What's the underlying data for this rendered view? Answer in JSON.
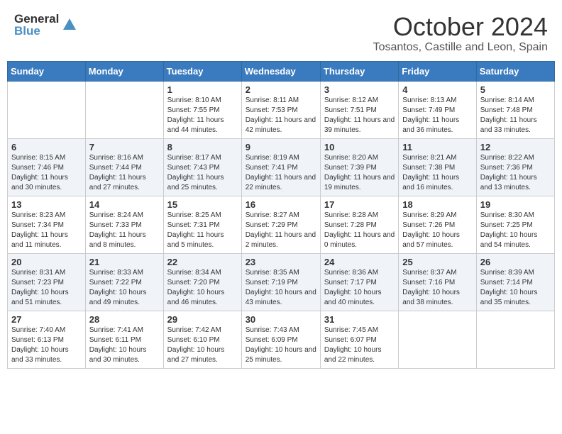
{
  "header": {
    "logo_general": "General",
    "logo_blue": "Blue",
    "month_title": "October 2024",
    "location": "Tosantos, Castille and Leon, Spain"
  },
  "days_of_week": [
    "Sunday",
    "Monday",
    "Tuesday",
    "Wednesday",
    "Thursday",
    "Friday",
    "Saturday"
  ],
  "weeks": [
    [
      {
        "day": "",
        "info": ""
      },
      {
        "day": "",
        "info": ""
      },
      {
        "day": "1",
        "info": "Sunrise: 8:10 AM\nSunset: 7:55 PM\nDaylight: 11 hours and 44 minutes."
      },
      {
        "day": "2",
        "info": "Sunrise: 8:11 AM\nSunset: 7:53 PM\nDaylight: 11 hours and 42 minutes."
      },
      {
        "day": "3",
        "info": "Sunrise: 8:12 AM\nSunset: 7:51 PM\nDaylight: 11 hours and 39 minutes."
      },
      {
        "day": "4",
        "info": "Sunrise: 8:13 AM\nSunset: 7:49 PM\nDaylight: 11 hours and 36 minutes."
      },
      {
        "day": "5",
        "info": "Sunrise: 8:14 AM\nSunset: 7:48 PM\nDaylight: 11 hours and 33 minutes."
      }
    ],
    [
      {
        "day": "6",
        "info": "Sunrise: 8:15 AM\nSunset: 7:46 PM\nDaylight: 11 hours and 30 minutes."
      },
      {
        "day": "7",
        "info": "Sunrise: 8:16 AM\nSunset: 7:44 PM\nDaylight: 11 hours and 27 minutes."
      },
      {
        "day": "8",
        "info": "Sunrise: 8:17 AM\nSunset: 7:43 PM\nDaylight: 11 hours and 25 minutes."
      },
      {
        "day": "9",
        "info": "Sunrise: 8:19 AM\nSunset: 7:41 PM\nDaylight: 11 hours and 22 minutes."
      },
      {
        "day": "10",
        "info": "Sunrise: 8:20 AM\nSunset: 7:39 PM\nDaylight: 11 hours and 19 minutes."
      },
      {
        "day": "11",
        "info": "Sunrise: 8:21 AM\nSunset: 7:38 PM\nDaylight: 11 hours and 16 minutes."
      },
      {
        "day": "12",
        "info": "Sunrise: 8:22 AM\nSunset: 7:36 PM\nDaylight: 11 hours and 13 minutes."
      }
    ],
    [
      {
        "day": "13",
        "info": "Sunrise: 8:23 AM\nSunset: 7:34 PM\nDaylight: 11 hours and 11 minutes."
      },
      {
        "day": "14",
        "info": "Sunrise: 8:24 AM\nSunset: 7:33 PM\nDaylight: 11 hours and 8 minutes."
      },
      {
        "day": "15",
        "info": "Sunrise: 8:25 AM\nSunset: 7:31 PM\nDaylight: 11 hours and 5 minutes."
      },
      {
        "day": "16",
        "info": "Sunrise: 8:27 AM\nSunset: 7:29 PM\nDaylight: 11 hours and 2 minutes."
      },
      {
        "day": "17",
        "info": "Sunrise: 8:28 AM\nSunset: 7:28 PM\nDaylight: 11 hours and 0 minutes."
      },
      {
        "day": "18",
        "info": "Sunrise: 8:29 AM\nSunset: 7:26 PM\nDaylight: 10 hours and 57 minutes."
      },
      {
        "day": "19",
        "info": "Sunrise: 8:30 AM\nSunset: 7:25 PM\nDaylight: 10 hours and 54 minutes."
      }
    ],
    [
      {
        "day": "20",
        "info": "Sunrise: 8:31 AM\nSunset: 7:23 PM\nDaylight: 10 hours and 51 minutes."
      },
      {
        "day": "21",
        "info": "Sunrise: 8:33 AM\nSunset: 7:22 PM\nDaylight: 10 hours and 49 minutes."
      },
      {
        "day": "22",
        "info": "Sunrise: 8:34 AM\nSunset: 7:20 PM\nDaylight: 10 hours and 46 minutes."
      },
      {
        "day": "23",
        "info": "Sunrise: 8:35 AM\nSunset: 7:19 PM\nDaylight: 10 hours and 43 minutes."
      },
      {
        "day": "24",
        "info": "Sunrise: 8:36 AM\nSunset: 7:17 PM\nDaylight: 10 hours and 40 minutes."
      },
      {
        "day": "25",
        "info": "Sunrise: 8:37 AM\nSunset: 7:16 PM\nDaylight: 10 hours and 38 minutes."
      },
      {
        "day": "26",
        "info": "Sunrise: 8:39 AM\nSunset: 7:14 PM\nDaylight: 10 hours and 35 minutes."
      }
    ],
    [
      {
        "day": "27",
        "info": "Sunrise: 7:40 AM\nSunset: 6:13 PM\nDaylight: 10 hours and 33 minutes."
      },
      {
        "day": "28",
        "info": "Sunrise: 7:41 AM\nSunset: 6:11 PM\nDaylight: 10 hours and 30 minutes."
      },
      {
        "day": "29",
        "info": "Sunrise: 7:42 AM\nSunset: 6:10 PM\nDaylight: 10 hours and 27 minutes."
      },
      {
        "day": "30",
        "info": "Sunrise: 7:43 AM\nSunset: 6:09 PM\nDaylight: 10 hours and 25 minutes."
      },
      {
        "day": "31",
        "info": "Sunrise: 7:45 AM\nSunset: 6:07 PM\nDaylight: 10 hours and 22 minutes."
      },
      {
        "day": "",
        "info": ""
      },
      {
        "day": "",
        "info": ""
      }
    ]
  ]
}
